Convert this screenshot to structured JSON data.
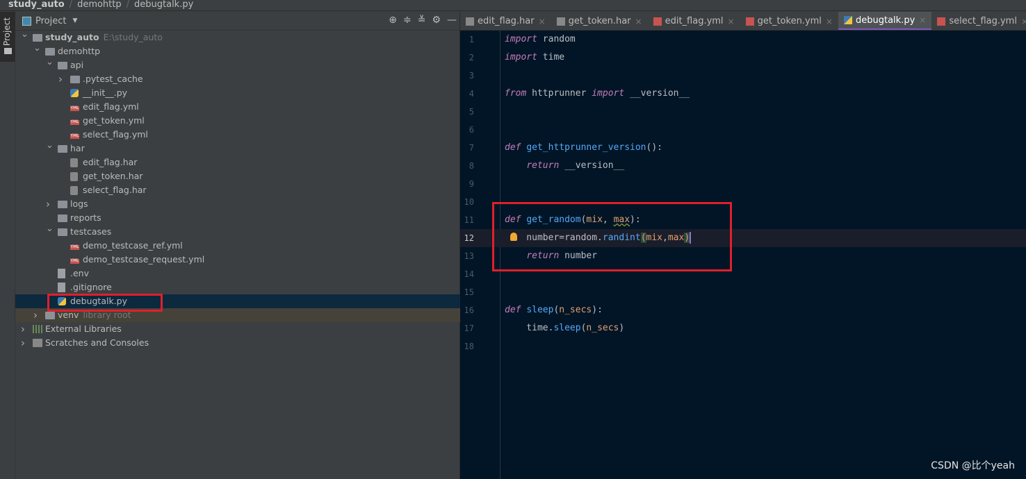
{
  "breadcrumb": [
    "study_auto",
    "demohttp",
    "debugtalk.py"
  ],
  "sidebar_strip": {
    "label": "Project"
  },
  "project_panel": {
    "title": "Project",
    "tools": [
      "locate-icon",
      "expand-all-icon",
      "collapse-all-icon",
      "gear-icon",
      "minimize-icon"
    ]
  },
  "tree": [
    {
      "label": "study_auto",
      "hint": "E:\\study_auto",
      "level": 0,
      "arrow": "down",
      "icon": "folder",
      "bold": true
    },
    {
      "label": "demohttp",
      "level": 1,
      "arrow": "down",
      "icon": "folder"
    },
    {
      "label": "api",
      "level": 2,
      "arrow": "down",
      "icon": "folder"
    },
    {
      "label": ".pytest_cache",
      "level": 3,
      "arrow": "right",
      "icon": "folder"
    },
    {
      "label": "__init__.py",
      "level": 3,
      "icon": "py"
    },
    {
      "label": "edit_flag.yml",
      "level": 3,
      "icon": "yml"
    },
    {
      "label": "get_token.yml",
      "level": 3,
      "icon": "yml"
    },
    {
      "label": "select_flag.yml",
      "level": 3,
      "icon": "yml"
    },
    {
      "label": "har",
      "level": 2,
      "arrow": "down",
      "icon": "folder"
    },
    {
      "label": "edit_flag.har",
      "level": 3,
      "icon": "har"
    },
    {
      "label": "get_token.har",
      "level": 3,
      "icon": "har"
    },
    {
      "label": "select_flag.har",
      "level": 3,
      "icon": "har"
    },
    {
      "label": "logs",
      "level": 2,
      "arrow": "right",
      "icon": "folder"
    },
    {
      "label": "reports",
      "level": 2,
      "icon": "folder"
    },
    {
      "label": "testcases",
      "level": 2,
      "arrow": "down",
      "icon": "folder"
    },
    {
      "label": "demo_testcase_ref.yml",
      "level": 3,
      "icon": "yml"
    },
    {
      "label": "demo_testcase_request.yml",
      "level": 3,
      "icon": "yml"
    },
    {
      "label": ".env",
      "level": 2,
      "icon": "file"
    },
    {
      "label": ".gitignore",
      "level": 2,
      "icon": "file"
    },
    {
      "label": "debugtalk.py",
      "level": 2,
      "icon": "py",
      "selected": true
    },
    {
      "label": "venv",
      "hint": "library root",
      "level": 1,
      "arrow": "right",
      "icon": "folder",
      "lib": true
    },
    {
      "label": "External Libraries",
      "level": 0,
      "arrow": "right",
      "icon": "libs"
    },
    {
      "label": "Scratches and Consoles",
      "level": 0,
      "arrow": "right",
      "icon": "scr"
    }
  ],
  "tabs": [
    {
      "label": "edit_flag.har",
      "icon": "har"
    },
    {
      "label": "get_token.har",
      "icon": "har"
    },
    {
      "label": "edit_flag.yml",
      "icon": "yml"
    },
    {
      "label": "get_token.yml",
      "icon": "yml"
    },
    {
      "label": "debugtalk.py",
      "icon": "py",
      "active": true
    },
    {
      "label": "select_flag.yml",
      "icon": "yml"
    },
    {
      "label": "select_flag.har",
      "icon": "har"
    }
  ],
  "code": [
    [
      [
        "kw",
        "import"
      ],
      [
        "t",
        " random"
      ]
    ],
    [
      [
        "kw",
        "import"
      ],
      [
        "t",
        " time"
      ]
    ],
    [],
    [
      [
        "kw",
        "from"
      ],
      [
        "t",
        " httprunner "
      ],
      [
        "kw",
        "import"
      ],
      [
        "t",
        " __version__"
      ]
    ],
    [],
    [],
    [
      [
        "kw",
        "def"
      ],
      [
        "t",
        " "
      ],
      [
        "fn",
        "get_httprunner_version"
      ],
      [
        "t",
        "():"
      ]
    ],
    [
      [
        "t",
        "    "
      ],
      [
        "kw",
        "return"
      ],
      [
        "t",
        " __version__"
      ]
    ],
    [],
    [],
    [
      [
        "kw",
        "def"
      ],
      [
        "t",
        " "
      ],
      [
        "fn",
        "get_random"
      ],
      [
        "t",
        "("
      ],
      [
        "pa",
        "mix"
      ],
      [
        "t",
        ", "
      ],
      [
        "paw",
        "max"
      ],
      [
        "t",
        "):"
      ]
    ],
    [
      [
        "t",
        "    number=random."
      ],
      [
        "mt",
        "randint"
      ],
      [
        "bm",
        "("
      ],
      [
        "pa",
        "mix"
      ],
      [
        "t",
        ","
      ],
      [
        "pa",
        "max"
      ],
      [
        "bm",
        ")"
      ],
      [
        "caret",
        ""
      ]
    ],
    [
      [
        "t",
        "    "
      ],
      [
        "kw",
        "return"
      ],
      [
        "t",
        " number"
      ]
    ],
    [],
    [],
    [
      [
        "kw",
        "def"
      ],
      [
        "t",
        " "
      ],
      [
        "fn",
        "sleep"
      ],
      [
        "t",
        "("
      ],
      [
        "pa",
        "n_secs"
      ],
      [
        "t",
        "):"
      ]
    ],
    [
      [
        "t",
        "    time."
      ],
      [
        "mt",
        "sleep"
      ],
      [
        "t",
        "("
      ],
      [
        "pa",
        "n_secs"
      ],
      [
        "t",
        ")"
      ]
    ],
    []
  ],
  "current_line": 12,
  "watermark": "CSDN @比个yeah",
  "colors": {
    "highlight_box": "#e0202a",
    "editor_bg": "#011526",
    "active_tab_underline": "#7e57c2"
  }
}
